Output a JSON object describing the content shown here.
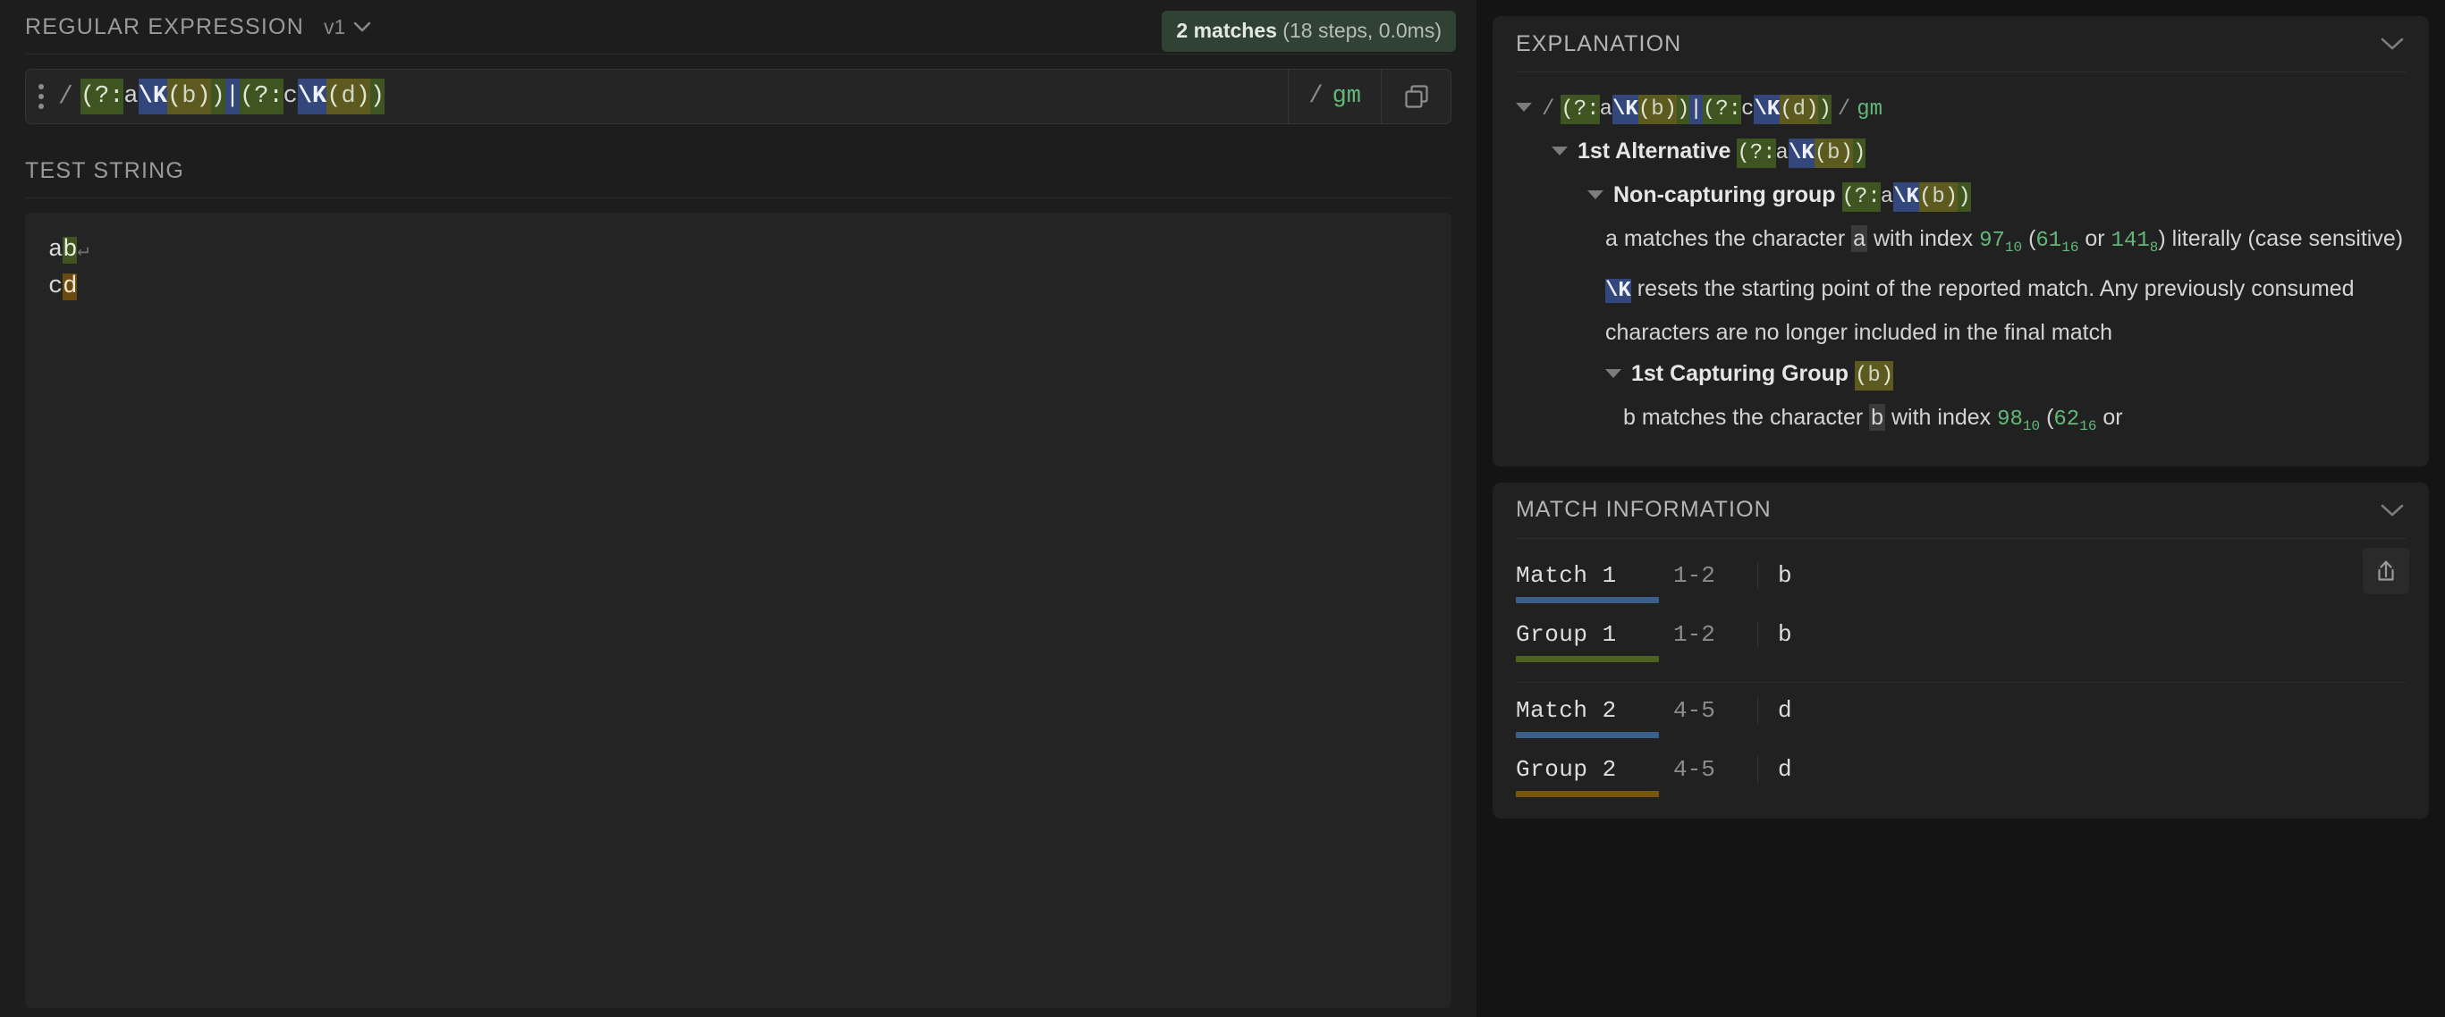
{
  "regex_panel": {
    "title": "REGULAR EXPRESSION",
    "version": "v1",
    "version_chevron_icon": "chevron-down-icon",
    "drag_handle_icon": "drag-handle-icon",
    "match_badge": {
      "count_text": "2 matches",
      "detail_text": " (18 steps, 0.0ms)",
      "bg_color": "#2f4233"
    },
    "delimiter": "/",
    "pattern": "(?:a\\K(b))|(?:c\\K(d))",
    "pattern_tokens": [
      {
        "text": "(?:",
        "style": "tk-group"
      },
      {
        "text": "a",
        "style": "tk-lit"
      },
      {
        "text": "\\K",
        "style": "tk-esc"
      },
      {
        "text": "(",
        "style": "tk-group2"
      },
      {
        "text": "b",
        "style": "tk-lit-y"
      },
      {
        "text": ")",
        "style": "tk-group2"
      },
      {
        "text": ")",
        "style": "tk-group"
      },
      {
        "text": "|",
        "style": "tk-alt"
      },
      {
        "text": "(?:",
        "style": "tk-group"
      },
      {
        "text": "c",
        "style": "tk-lit"
      },
      {
        "text": "\\K",
        "style": "tk-esc"
      },
      {
        "text": "(",
        "style": "tk-group2"
      },
      {
        "text": "d",
        "style": "tk-lit-y"
      },
      {
        "text": ")",
        "style": "tk-group2"
      },
      {
        "text": ")",
        "style": "tk-group"
      }
    ],
    "flags_slash": "/",
    "flags": "gm",
    "copy_icon": "copy-icon"
  },
  "test_string_panel": {
    "title": "TEST STRING",
    "lines": [
      {
        "pre": "a",
        "hl": "b",
        "hl_style": "hl-green",
        "post": "",
        "newline_mark": "↵"
      },
      {
        "pre": "c",
        "hl": "d",
        "hl_style": "hl-brown",
        "post": "",
        "newline_mark": ""
      }
    ],
    "raw": "ab\ncd"
  },
  "explanation_panel": {
    "title": "EXPLANATION",
    "collapse_icon": "chevron-down-icon",
    "root": {
      "slash_left": "/",
      "slash_right": "/",
      "flags": "gm"
    },
    "nodes": {
      "alternative_label": "1st Alternative",
      "alternative_pattern": "(?:a\\K(b))",
      "noncapturing_label": "Non-capturing group",
      "noncapturing_pattern": "(?:a\\K(b))",
      "a_desc_pre": "a matches the character ",
      "a_desc_char": "a",
      "a_desc_mid": " with index ",
      "a_dec": "97",
      "a_dec_sub": "10",
      "a_hex_open": " (",
      "a_hex": "61",
      "a_hex_sub": "16",
      "a_or": " or ",
      "a_oct": "141",
      "a_oct_sub": "8",
      "a_desc_post": ") literally (case sensitive)",
      "k_token": "\\K",
      "k_desc": " resets the starting point of the reported match. Any previously consumed characters are no longer included in the final match",
      "capgroup_label": "1st Capturing Group",
      "capgroup_pattern": "(b)",
      "b_desc_pre": "b matches the character ",
      "b_desc_char": "b",
      "b_desc_mid": " with index ",
      "b_dec": "98",
      "b_dec_sub": "10",
      "b_hex_open": " (",
      "b_hex": "62",
      "b_hex_sub": "16",
      "b_or": " or"
    }
  },
  "match_information_panel": {
    "title": "MATCH INFORMATION",
    "collapse_icon": "chevron-down-icon",
    "share_icon": "share-export-icon",
    "rows": [
      {
        "label": "Match 1",
        "range": "1-2",
        "value": "b",
        "underline_color": "#3c5f8a",
        "group_start": false
      },
      {
        "label": "Group 1",
        "range": "1-2",
        "value": "b",
        "underline_color": "#4c6420",
        "group_start": false
      },
      {
        "label": "Match 2",
        "range": "4-5",
        "value": "d",
        "underline_color": "#3c5f8a",
        "group_start": true
      },
      {
        "label": "Group 2",
        "range": "4-5",
        "value": "d",
        "underline_color": "#7a5510",
        "group_start": false
      }
    ]
  },
  "colors": {
    "page_bg": "#141414",
    "left_bg": "#1d1d1d",
    "panel_bg": "#212121",
    "accent_green": "#62b878",
    "group_green": "#3f5521",
    "group_yellow": "#5c5a1f",
    "escape_blue": "#33477d",
    "highlight_brown": "#6b4a10"
  }
}
